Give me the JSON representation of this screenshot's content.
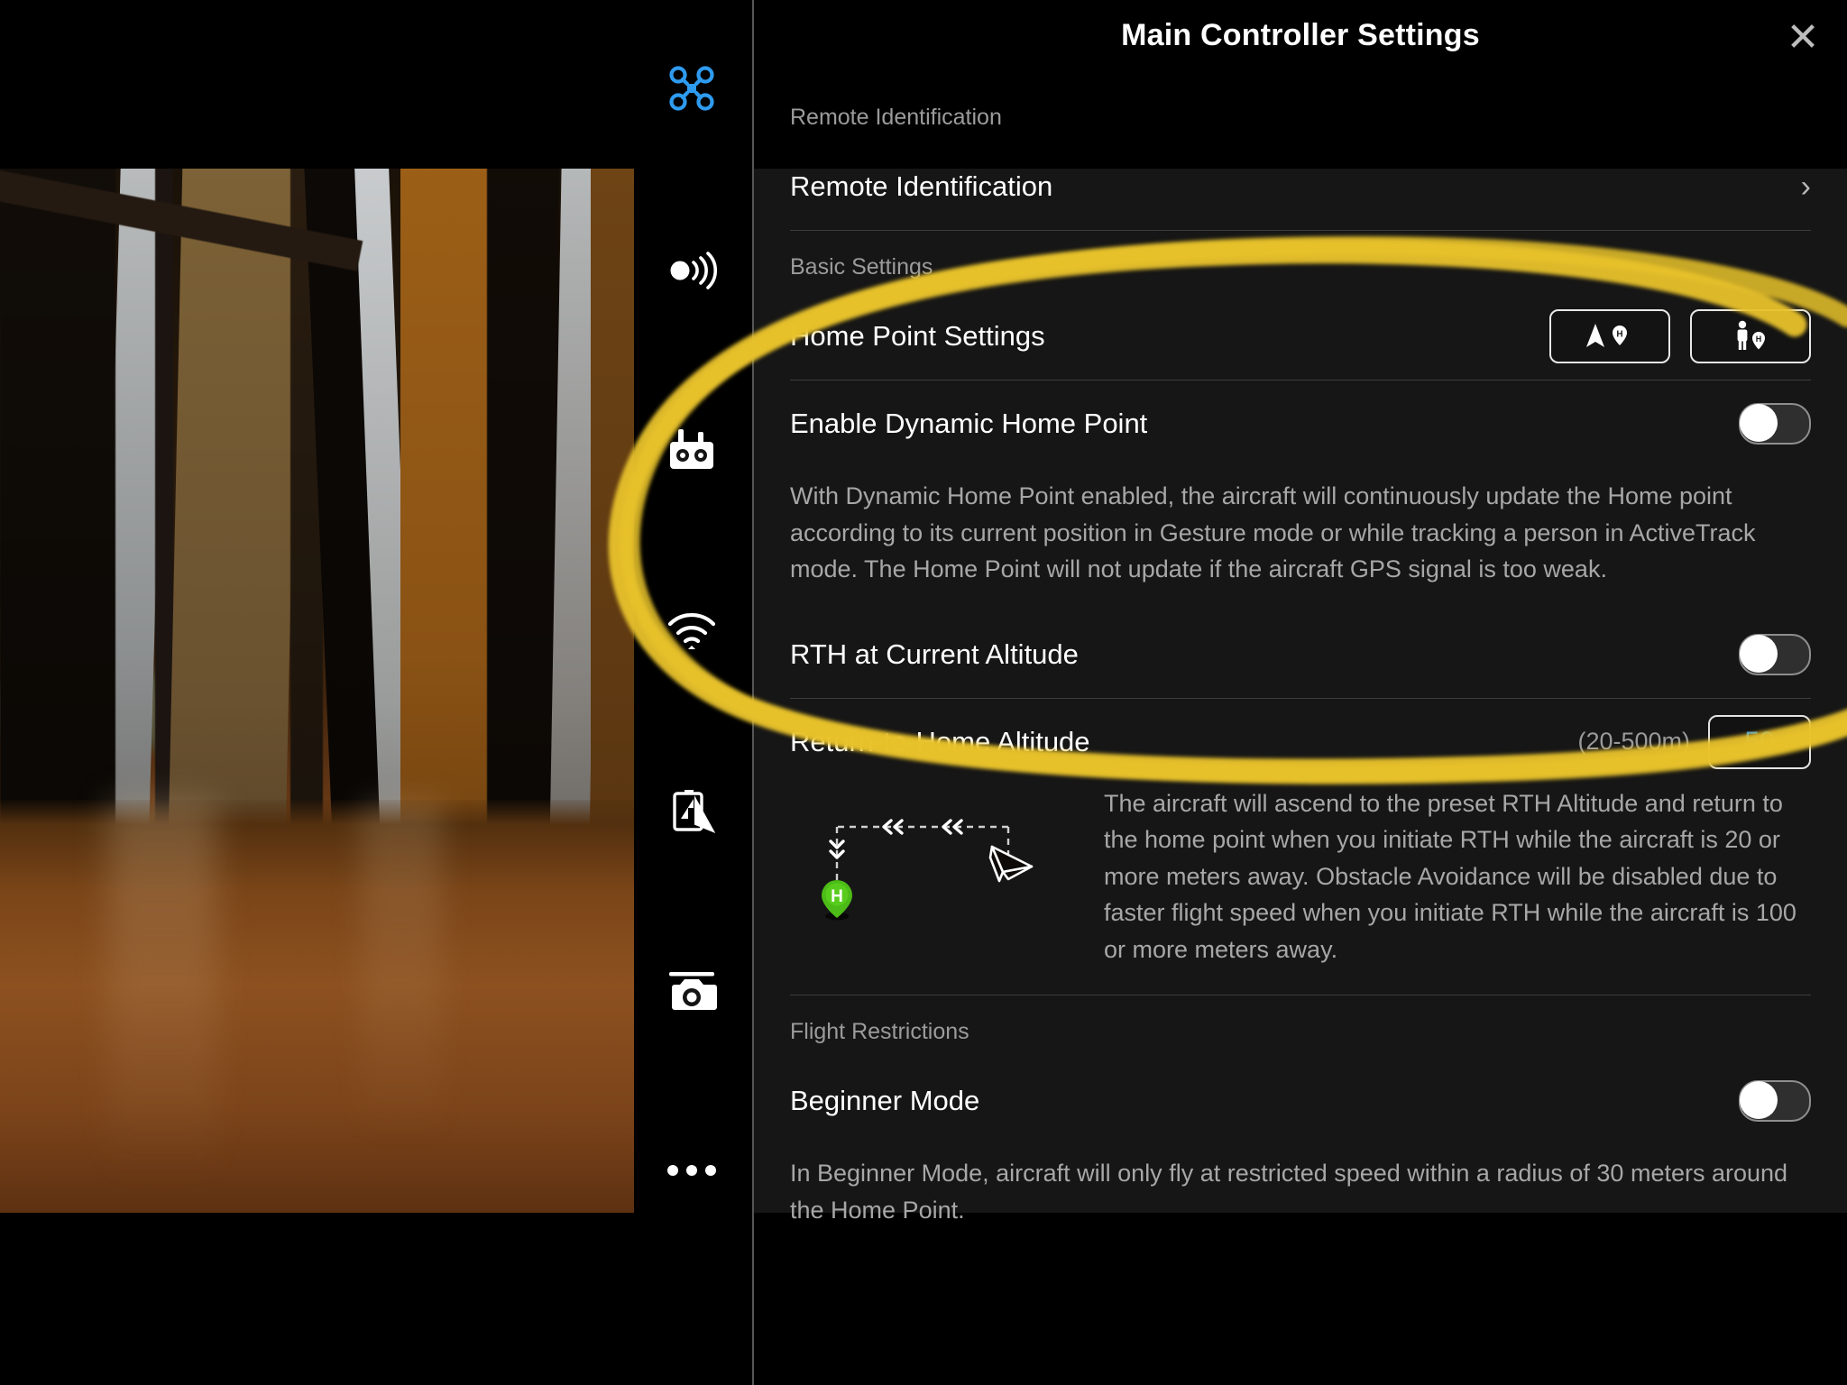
{
  "header": {
    "title": "Main Controller Settings",
    "close_icon": "close-icon",
    "close_glyph": "✕"
  },
  "rail": {
    "items": [
      {
        "name": "aircraft-icon",
        "label": "Aircraft"
      },
      {
        "name": "sensing-icon",
        "label": "Sensing"
      },
      {
        "name": "remote-controller-icon",
        "label": "Remote Controller"
      },
      {
        "name": "transmission-icon",
        "label": "Transmission"
      },
      {
        "name": "battery-icon",
        "label": "Battery"
      },
      {
        "name": "camera-icon",
        "label": "Camera"
      },
      {
        "name": "more-icon",
        "label": "More"
      }
    ]
  },
  "sections": {
    "remote_identification": {
      "heading": "Remote Identification",
      "row_label": "Remote Identification",
      "chevron": "›"
    },
    "basic_settings": {
      "heading": "Basic Settings",
      "home_point": {
        "label": "Home Point Settings",
        "buttons": [
          {
            "name": "home-point-aircraft-button",
            "icon": "aircraft-home-pin-icon",
            "pin_letter": "H"
          },
          {
            "name": "home-point-person-button",
            "icon": "person-home-pin-icon",
            "pin_letter": "H"
          }
        ]
      },
      "dynamic_home_point": {
        "label": "Enable Dynamic Home Point",
        "toggle_state": "off",
        "description": "With Dynamic Home Point enabled, the aircraft will continuously update the Home point according to its current position in Gesture mode or while tracking a person in ActiveTrack mode. The Home Point will not update if the aircraft GPS signal is too weak."
      },
      "rth_current_altitude": {
        "label": "RTH at Current Altitude",
        "toggle_state": "off"
      },
      "rth_altitude": {
        "label": "Return-to-Home Altitude",
        "range": "(20-500m)",
        "value": "50",
        "description": "The aircraft will ascend to the preset RTH Altitude and return to the home point when you initiate RTH while the aircraft is 20 or more meters away. Obstacle Avoidance will be disabled due to faster flight speed when you initiate RTH while the aircraft is 100 or more meters away.",
        "diagram": {
          "home_pin_letter": "H",
          "aircraft_icon": "paper-plane-icon",
          "path_arrows": "«"
        }
      }
    },
    "flight_restrictions": {
      "heading": "Flight Restrictions",
      "beginner_mode": {
        "label": "Beginner Mode",
        "toggle_state": "off",
        "description": "In Beginner Mode, aircraft will only fly at restricted speed within a radius of 30 meters around the Home Point."
      }
    }
  },
  "annotation": {
    "name": "yellow-highlight-ellipse",
    "color": "#e8c22a",
    "shape": "ellipse"
  },
  "colors": {
    "accent_blue": "#2e9bf0",
    "home_pin_green": "#4cbb17",
    "annotation_yellow": "#e8c22a",
    "panel_bg": "#1c1c1c"
  }
}
